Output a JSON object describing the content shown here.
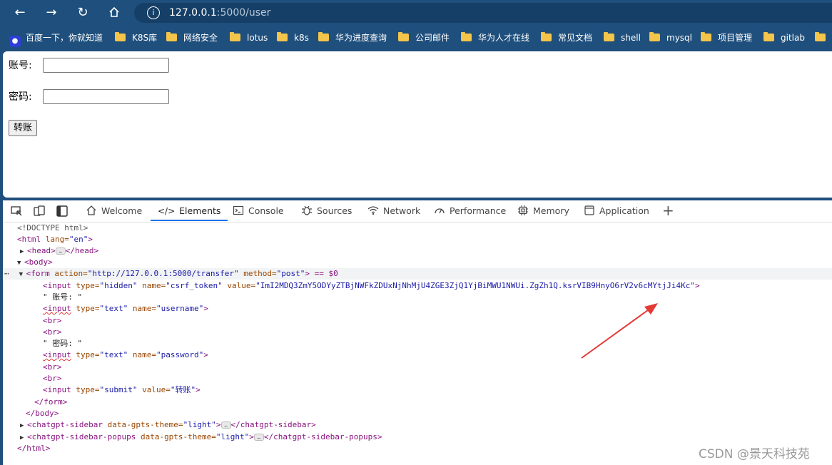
{
  "browser": {
    "url_host": "127.0.0.1",
    "url_rest": ":5000/user",
    "bookmarks": [
      {
        "label": "百度一下，你就知道",
        "icon": "baidu-icon"
      },
      {
        "label": "K8S库",
        "icon": "folder-icon"
      },
      {
        "label": "网络安全",
        "icon": "folder-icon"
      },
      {
        "label": "lotus",
        "icon": "folder-icon"
      },
      {
        "label": "k8s",
        "icon": "folder-icon"
      },
      {
        "label": "华为进度查询",
        "icon": "folder-icon"
      },
      {
        "label": "公司邮件",
        "icon": "folder-icon"
      },
      {
        "label": "华为人才在线",
        "icon": "folder-icon"
      },
      {
        "label": "常见文档",
        "icon": "folder-icon"
      },
      {
        "label": "shell",
        "icon": "folder-icon"
      },
      {
        "label": "mysql",
        "icon": "folder-icon"
      },
      {
        "label": "项目管理",
        "icon": "folder-icon"
      },
      {
        "label": "gitlab",
        "icon": "folder-icon"
      }
    ]
  },
  "page": {
    "account_label": "账号:",
    "password_label": "密码:",
    "submit_label": "转账"
  },
  "devtools": {
    "tabs": [
      "Welcome",
      "Elements",
      "Console",
      "Sources",
      "Network",
      "Performance",
      "Memory",
      "Application"
    ],
    "active_tab": "Elements",
    "code": {
      "doctype": "<!DOCTYPE html>",
      "html_open_tag": "<html",
      "html_lang_attr": " lang=",
      "html_lang_val": "\"en\"",
      "gt": ">",
      "head_open": "<head>",
      "head_close": "</head>",
      "body_open": "<body>",
      "form_open": "<form",
      "form_action_attr": " action=",
      "form_action_val": "\"http://127.0.0.1:5000/transfer\"",
      "form_method_attr": " method=",
      "form_method_val": "\"post\"",
      "form_eq": "> == $0",
      "input_tag": "<input",
      "type_attr": " type=",
      "hidden_val": "\"hidden\"",
      "name_attr": " name=",
      "csrf_name_val": "\"csrf_token\"",
      "value_attr": " value=",
      "csrf_value": "\"ImI2MDQ3ZmY5ODYyZTBjNWFkZDUxNjNhMjU4ZGE3ZjQ1YjBiMWU1NWUi.ZgZh1Q.ksrVIB9HnyO6rV2v6cMYtjJi4Kc\"",
      "account_text": "\" 账号: \"",
      "text_val": "\"text\"",
      "username_val": "\"username\"",
      "br": "<br>",
      "password_text": "\" 密码: \"",
      "password_val": "\"password\"",
      "submit_val": "\"submit\"",
      "transfer_val": "\"转账\"",
      "form_close": "</form>",
      "body_close": "</body>",
      "sidebar_open": "<chatgpt-sidebar",
      "theme_attr": " data-gpts-theme=",
      "theme_val": "\"light\"",
      "sidebar_close": "</chatgpt-sidebar>",
      "popups_open": "<chatgpt-sidebar-popups",
      "popups_close": "</chatgpt-sidebar-popups>",
      "html_close": "</html>"
    }
  },
  "watermark": "CSDN @景天科技苑",
  "colors": {
    "browser_frame": "#1f4f7c",
    "accent": "#1a73e8",
    "arrow": "#e53935"
  }
}
